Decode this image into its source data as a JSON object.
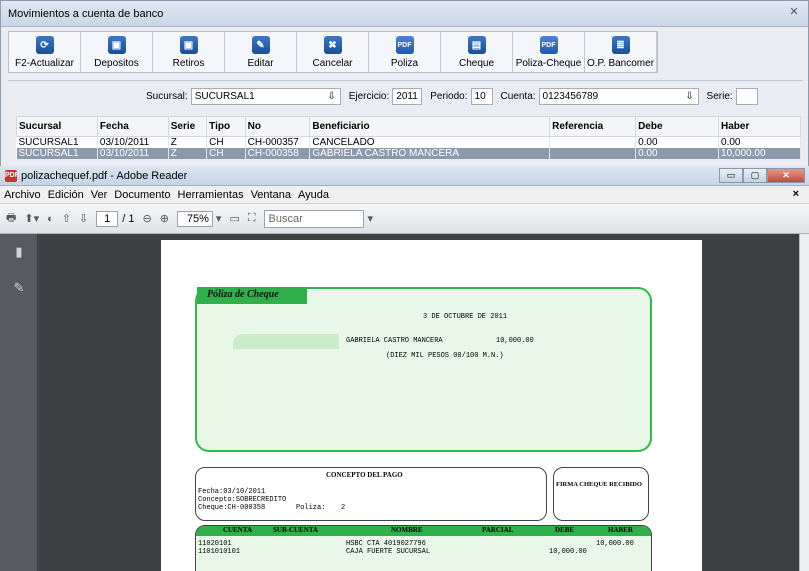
{
  "bg_window": {
    "title": "Movimientos a cuenta de banco",
    "close_glyph": "✕",
    "toolbar": [
      {
        "label": "F2-Actualizar",
        "icon": "refresh-icon",
        "glyph": "⟳"
      },
      {
        "label": "Depositos",
        "icon": "deposit-icon",
        "glyph": "▣"
      },
      {
        "label": "Retiros",
        "icon": "withdraw-icon",
        "glyph": "▣"
      },
      {
        "label": "Editar",
        "icon": "edit-icon",
        "glyph": "✎"
      },
      {
        "label": "Cancelar",
        "icon": "cancel-icon",
        "glyph": "✖"
      },
      {
        "label": "Poliza",
        "icon": "pdf-icon",
        "glyph": "PDF"
      },
      {
        "label": "Cheque",
        "icon": "printer-icon",
        "glyph": "▤"
      },
      {
        "label": "Poliza-Cheque",
        "icon": "pdf-icon",
        "glyph": "PDF"
      },
      {
        "label": "O.P. Bancomer",
        "icon": "document-icon",
        "glyph": "≣"
      }
    ],
    "filters": {
      "sucursal_label": "Sucursal:",
      "sucursal_value": "SUCURSAL1",
      "ejercicio_label": "Ejercicio:",
      "ejercicio_value": "2011",
      "periodo_label": "Periodo:",
      "periodo_value": "10",
      "cuenta_label": "Cuenta:",
      "cuenta_value": "0123456789",
      "serie_label": "Serie:",
      "serie_value": "",
      "dropdown_glyph": "⇩"
    },
    "columns": [
      "Sucursal",
      "Fecha",
      "Serie",
      "Tipo",
      "No",
      "Beneficiario",
      "Referencia",
      "Debe",
      "Haber"
    ],
    "rows": [
      [
        "SUCURSAL1",
        "03/10/2011",
        "Z",
        "CH",
        "CH-000357",
        "CANCELADO",
        "",
        "0.00",
        "0.00"
      ],
      [
        "SUCURSAL1",
        "03/10/2011",
        "Z",
        "CH",
        "CH-000358",
        "GABRIELA CASTRO MANCERA",
        "",
        "0.00",
        "10,000.00"
      ]
    ]
  },
  "reader": {
    "title": "polizachequef.pdf - Adobe Reader",
    "pdf_badge": "PDF",
    "win_min": "▭",
    "win_max": "▢",
    "win_close": "✕",
    "menu": [
      "Archivo",
      "Edición",
      "Ver",
      "Documento",
      "Herramientas",
      "Ventana",
      "Ayuda"
    ],
    "menu_close": "×",
    "toolbar": {
      "print_glyph": "🖶",
      "share_glyph": "⬆▾",
      "back_glyph": "◐",
      "up_glyph": "⇧",
      "down_glyph": "⇩",
      "page_current": "1",
      "page_total": "/ 1",
      "zoom_out_glyph": "⊖",
      "zoom_in_glyph": "⊕",
      "zoom": "75%",
      "zoom_dd": "▾",
      "fit_page_glyph": "▭",
      "fit_width_glyph": "⛶",
      "search_placeholder": "Buscar",
      "search_dd": "▾"
    },
    "side": {
      "pages_glyph": "▮",
      "sign_glyph": "✎"
    }
  },
  "pdf": {
    "tag_title": "Póliza de Cheque",
    "fecha_larga": "3 DE OCTUBRE DE 2011",
    "beneficiario": "GABRIELA CASTRO MANCERA",
    "importe": "10,000.00",
    "importe_letra": "(DIEZ MIL PESOS 00/100 M.N.)",
    "concepto_header": "CONCEPTO DEL PAGO",
    "firma_header": "FIRMA CHEQUE RECIBIDO",
    "concepto_fecha": "Fecha:03/10/2011",
    "concepto_concepto": "Concepto:SOBRECREDITO",
    "concepto_cheque": "Cheque:CH-000358",
    "concepto_poliza_label": "Poliza:",
    "concepto_poliza_value": "2",
    "detail_headers": {
      "cuenta": "CUENTA",
      "subcuenta": "SUB-CUENTA",
      "nombre": "NOMBRE",
      "parcial": "PARCIAL",
      "debe": "DEBE",
      "haber": "HABER"
    },
    "detail_rows": [
      {
        "cuenta": "11020101",
        "nombre": "HSBC CTA 4019027796",
        "debe": "",
        "haber": "10,000.00"
      },
      {
        "cuenta": "1101010101",
        "nombre": "CAJA FUERTE SUCURSAL",
        "debe": "10,000.00",
        "haber": ""
      }
    ]
  }
}
